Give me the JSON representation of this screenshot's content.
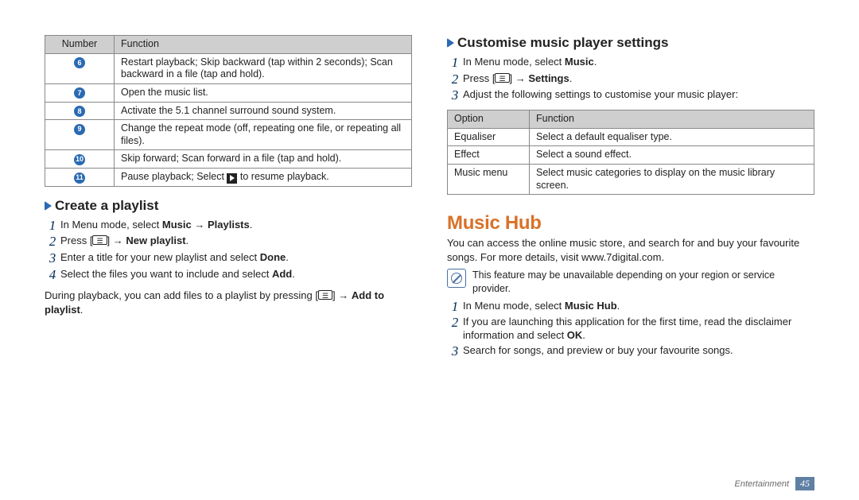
{
  "table1": {
    "headers": [
      "Number",
      "Function"
    ],
    "rows": [
      {
        "num": "6",
        "fn": "Restart playback; Skip backward (tap within 2 seconds); Scan backward in a file (tap and hold)."
      },
      {
        "num": "7",
        "fn": "Open the music list."
      },
      {
        "num": "8",
        "fn": "Activate the 5.1 channel surround sound system."
      },
      {
        "num": "9",
        "fn": "Change the repeat mode (off, repeating one file, or repeating all files)."
      },
      {
        "num": "10",
        "fn": "Skip forward; Scan forward in a file (tap and hold)."
      },
      {
        "num": "11",
        "fn_pre": "Pause playback; Select ",
        "fn_post": " to resume playback."
      }
    ]
  },
  "left": {
    "heading": "Create a playlist",
    "steps": [
      {
        "pre": "In Menu mode, select ",
        "b1": "Music",
        "mid": " → ",
        "b2": "Playlists",
        "post": "."
      },
      {
        "pre": "Press [",
        "post": "] → ",
        "b1": "New playlist",
        "post2": "."
      },
      {
        "pre": "Enter a title for your new playlist and select ",
        "b1": "Done",
        "post": "."
      },
      {
        "pre": "Select the files you want to include and select ",
        "b1": "Add",
        "post": "."
      }
    ],
    "note_pre": "During playback, you can add files to a playlist by pressing [",
    "note_mid": "] → ",
    "note_b": "Add to playlist",
    "note_post": "."
  },
  "right": {
    "heading": "Customise music player settings",
    "steps": [
      {
        "pre": "In Menu mode, select ",
        "b1": "Music",
        "post": "."
      },
      {
        "pre": "Press [",
        "post": "] → ",
        "b1": "Settings",
        "post2": "."
      },
      {
        "pre": "Adjust the following settings to customise your music player:"
      }
    ],
    "table": {
      "headers": [
        "Option",
        "Function"
      ],
      "rows": [
        {
          "opt": "Equaliser",
          "fn": "Select a default equaliser type."
        },
        {
          "opt": "Effect",
          "fn": "Select a sound effect."
        },
        {
          "opt": "Music menu",
          "fn": "Select music categories to display on the music library screen."
        }
      ]
    },
    "hub": {
      "title": "Music Hub",
      "intro": "You can access the online music store, and search for and buy your favourite songs. For more details, visit www.7digital.com.",
      "note": "This feature may be unavailable depending on your region or service provider.",
      "steps": [
        {
          "pre": "In Menu mode, select ",
          "b1": "Music Hub",
          "post": "."
        },
        {
          "pre": "If you are launching this application for the first time, read the disclaimer information and select ",
          "b1": "OK",
          "post": "."
        },
        {
          "pre": "Search for songs, and preview or buy your favourite songs."
        }
      ]
    }
  },
  "footer": {
    "category": "Entertainment",
    "page": "45"
  }
}
